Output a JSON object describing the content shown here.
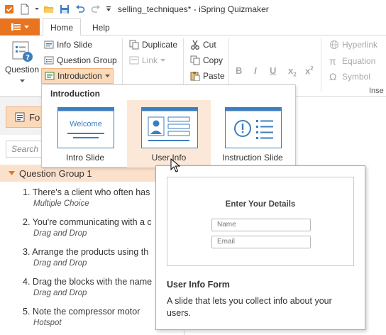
{
  "window": {
    "title": "selling_techniques* - iSpring Quizmaker"
  },
  "tabs": {
    "home": "Home",
    "help": "Help"
  },
  "ribbon": {
    "question": "Question",
    "info_slide": "Info Slide",
    "question_group": "Question Group",
    "introduction": "Introduction",
    "duplicate": "Duplicate",
    "link": "Link",
    "cut": "Cut",
    "copy": "Copy",
    "paste": "Paste",
    "hyperlink": "Hyperlink",
    "equation": "Equation",
    "symbol": "Symbol",
    "insert": "Inse",
    "bold": "B",
    "italic": "I",
    "underline": "U",
    "subscript": "x",
    "subscript_small": "2",
    "superscript": "x",
    "superscript_small": "2"
  },
  "left": {
    "form_label": "Fo",
    "search_placeholder": "Search",
    "group": "Question Group 1",
    "items": [
      {
        "num": "1.",
        "title": "There's a client who often has",
        "kind": "Multiple Choice"
      },
      {
        "num": "2.",
        "title": "You're communicating with a c",
        "kind": "Drag and Drop"
      },
      {
        "num": "3.",
        "title": "Arrange the products using th",
        "kind": "Drag and Drop"
      },
      {
        "num": "4.",
        "title": "Drag the blocks with the name",
        "kind": "Drag and Drop"
      },
      {
        "num": "5.",
        "title": "Note the compressor motor",
        "kind": "Hotspot"
      }
    ]
  },
  "dropdown": {
    "header": "Introduction",
    "items": [
      {
        "label": "Intro Slide",
        "thumb_text": "Welcome"
      },
      {
        "label": "User Info"
      },
      {
        "label": "Instruction Slide"
      }
    ]
  },
  "tooltip": {
    "preview_heading": "Enter Your Details",
    "name_placeholder": "Name",
    "email_placeholder": "Email",
    "title": "User Info Form",
    "description": "A slide that lets you collect info about your users."
  },
  "colors": {
    "accent": "#e8741f",
    "highlight": "#fbd9b9",
    "group_bg": "#fbe1cc",
    "thumb_blue": "#3d7ebf"
  }
}
